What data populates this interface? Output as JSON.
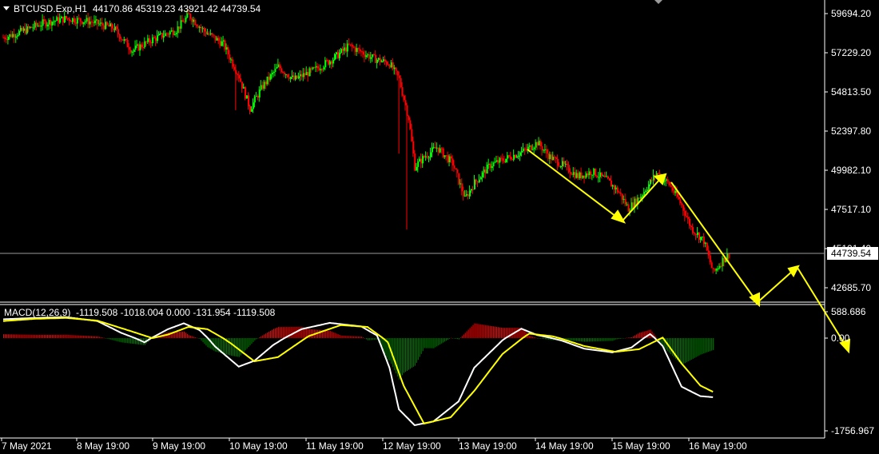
{
  "header": {
    "symbol": "BTCUSD.Exp,H1",
    "ohlc": "44170.86 45319.23 43921.42 44739.54"
  },
  "macd_header": {
    "label": "MACD(12,26,9)",
    "values": "-1119.508 -1018.004 0.000 -131.954 -1119.508"
  },
  "price_axis": {
    "ticks": [
      "59694.20",
      "57229.20",
      "54813.50",
      "52397.80",
      "49982.10",
      "47517.10",
      "45101.40",
      "42685.70"
    ],
    "current": "44739.54"
  },
  "macd_axis": {
    "ticks": [
      "588.686",
      "0.00",
      "-1756.967"
    ]
  },
  "time_axis": {
    "ticks": [
      "7 May 2021",
      "8 May 19:00",
      "9 May 19:00",
      "10 May 19:00",
      "11 May 19:00",
      "12 May 19:00",
      "13 May 19:00",
      "14 May 19:00",
      "15 May 19:00",
      "16 May 19:00"
    ]
  },
  "colors": {
    "background": "#000000",
    "bull": "#00ff00",
    "bear": "#ff0000",
    "hist_pos": "#ff0000",
    "hist_neg": "#008000",
    "macd_line": "#ffffff",
    "signal_line": "#ffff00",
    "arrow": "#ffff00"
  },
  "chart_data": [
    {
      "type": "candlestick",
      "title": "BTCUSD.Exp,H1",
      "ylim": [
        41500,
        60500
      ],
      "close_approx": [
        [
          0,
          58200
        ],
        [
          12,
          58600
        ],
        [
          25,
          59100
        ],
        [
          40,
          59400
        ],
        [
          55,
          59200
        ],
        [
          70,
          58800
        ],
        [
          82,
          57400
        ],
        [
          95,
          58100
        ],
        [
          110,
          58700
        ],
        [
          118,
          59600
        ],
        [
          128,
          58600
        ],
        [
          140,
          57800
        ],
        [
          150,
          55800
        ],
        [
          157,
          53800
        ],
        [
          165,
          55200
        ],
        [
          175,
          56400
        ],
        [
          185,
          55600
        ],
        [
          198,
          56200
        ],
        [
          210,
          56900
        ],
        [
          220,
          57700
        ],
        [
          228,
          57300
        ],
        [
          236,
          56900
        ],
        [
          246,
          56600
        ],
        [
          252,
          55600
        ],
        [
          258,
          53200
        ],
        [
          262,
          50200
        ],
        [
          268,
          50800
        ],
        [
          276,
          51400
        ],
        [
          286,
          50400
        ],
        [
          294,
          48200
        ],
        [
          300,
          49200
        ],
        [
          310,
          50300
        ],
        [
          320,
          50700
        ],
        [
          332,
          51200
        ],
        [
          340,
          51700
        ],
        [
          348,
          50800
        ],
        [
          356,
          50300
        ],
        [
          366,
          49600
        ],
        [
          375,
          49900
        ],
        [
          385,
          49300
        ],
        [
          392,
          48600
        ],
        [
          398,
          47600
        ],
        [
          406,
          48400
        ],
        [
          416,
          49800
        ],
        [
          424,
          49100
        ],
        [
          432,
          47800
        ],
        [
          438,
          46400
        ],
        [
          446,
          45600
        ],
        [
          452,
          43600
        ],
        [
          458,
          44400
        ],
        [
          462,
          44739.54
        ]
      ]
    },
    {
      "type": "line",
      "title": "MACD(12,26,9)",
      "ylim": [
        -1800,
        700
      ],
      "series": [
        {
          "values_approx": [
            [
              0,
              420
            ],
            [
              20,
              450
            ],
            [
              40,
              470
            ],
            [
              60,
              380
            ],
            [
              75,
              120
            ],
            [
              90,
              -80
            ],
            [
              105,
              200
            ],
            [
              115,
              330
            ],
            [
              125,
              180
            ],
            [
              135,
              -160
            ],
            [
              150,
              -540
            ],
            [
              160,
              -430
            ],
            [
              172,
              -130
            ],
            [
              190,
              200
            ],
            [
              208,
              340
            ],
            [
              228,
              260
            ],
            [
              238,
              60
            ],
            [
              246,
              -560
            ],
            [
              252,
              -1350
            ],
            [
              262,
              -1650
            ],
            [
              274,
              -1580
            ],
            [
              290,
              -1200
            ],
            [
              300,
              -560
            ],
            [
              318,
              -40
            ],
            [
              330,
              210
            ],
            [
              340,
              70
            ],
            [
              356,
              -50
            ],
            [
              370,
              -200
            ],
            [
              388,
              -270
            ],
            [
              400,
              -180
            ],
            [
              412,
              90
            ],
            [
              420,
              -150
            ],
            [
              432,
              -920
            ],
            [
              444,
              -1100
            ],
            [
              452,
              -1119.508
            ]
          ]
        },
        {
          "values_approx": [
            [
              0,
              380
            ],
            [
              20,
              430
            ],
            [
              40,
              450
            ],
            [
              60,
              390
            ],
            [
              80,
              170
            ],
            [
              95,
              0
            ],
            [
              105,
              80
            ],
            [
              118,
              250
            ],
            [
              130,
              200
            ],
            [
              145,
              -100
            ],
            [
              160,
              -440
            ],
            [
              175,
              -360
            ],
            [
              195,
              50
            ],
            [
              215,
              290
            ],
            [
              232,
              250
            ],
            [
              245,
              -80
            ],
            [
              255,
              -900
            ],
            [
              268,
              -1620
            ],
            [
              285,
              -1500
            ],
            [
              300,
              -1000
            ],
            [
              318,
              -300
            ],
            [
              335,
              100
            ],
            [
              350,
              40
            ],
            [
              370,
              -150
            ],
            [
              390,
              -260
            ],
            [
              405,
              -210
            ],
            [
              420,
              10
            ],
            [
              432,
              -480
            ],
            [
              444,
              -900
            ],
            [
              452,
              -1018.004
            ]
          ]
        }
      ]
    }
  ]
}
